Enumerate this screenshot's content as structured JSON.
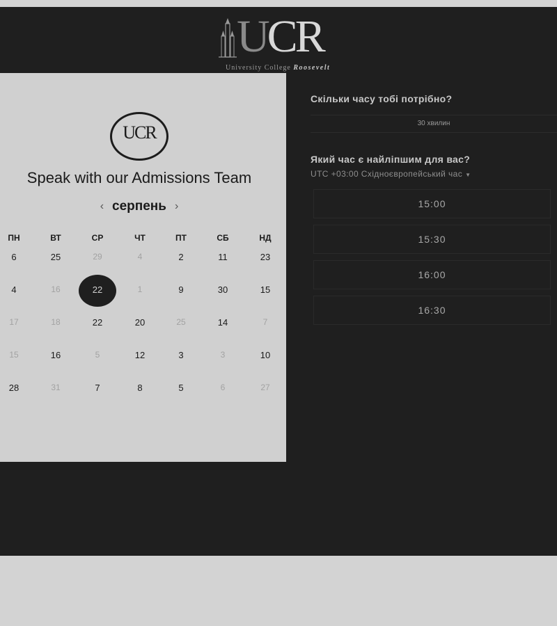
{
  "logo": {
    "letters_u": "U",
    "letters_cr": "CR",
    "subtitle": "University College ",
    "subtitle_bold": "Roosevelt"
  },
  "card": {
    "badge": "UCR",
    "title": "Speak with our Admissions Team",
    "month": "серпень",
    "prev_icon": "chevron-left-icon",
    "next_icon": "chevron-right-icon",
    "weekdays": [
      "ПН",
      "ВТ",
      "СР",
      "ЧТ",
      "ПТ",
      "СБ",
      "НД"
    ],
    "weeks": [
      [
        "6",
        "25",
        "29",
        "4",
        "2",
        "11",
        "23"
      ],
      [
        "4",
        "16",
        "22",
        "1",
        "9",
        "30",
        "15"
      ],
      [
        "17",
        "18",
        "22",
        "20",
        "25",
        "14",
        "7"
      ],
      [
        "15",
        "16",
        "5",
        "12",
        "3",
        "3",
        "10"
      ],
      [
        "28",
        "31",
        "7",
        "8",
        "5",
        "6",
        "27"
      ]
    ],
    "dim": [
      [
        false,
        false,
        true,
        true,
        false,
        false,
        false
      ],
      [
        false,
        true,
        false,
        true,
        false,
        false,
        false
      ],
      [
        true,
        true,
        false,
        false,
        true,
        false,
        true
      ],
      [
        true,
        false,
        true,
        false,
        false,
        true,
        false
      ],
      [
        false,
        true,
        false,
        false,
        false,
        true,
        true
      ]
    ],
    "selected": [
      1,
      2
    ]
  },
  "booking": {
    "duration_question": "Скільки часу тобі потрібно?",
    "duration_value": "30 хвилин",
    "time_question": "Який час є найліпшим для вас?",
    "timezone": "UTC +03:00 Східноєвропейський час",
    "caret_icon": "caret-down-icon",
    "slots": [
      "15:00",
      "15:30",
      "16:00",
      "16:30"
    ]
  },
  "colors": {
    "page_bg": "#d3d3d3",
    "stage_bg": "#1f1f1f",
    "card_bg": "#d0d0d0"
  }
}
